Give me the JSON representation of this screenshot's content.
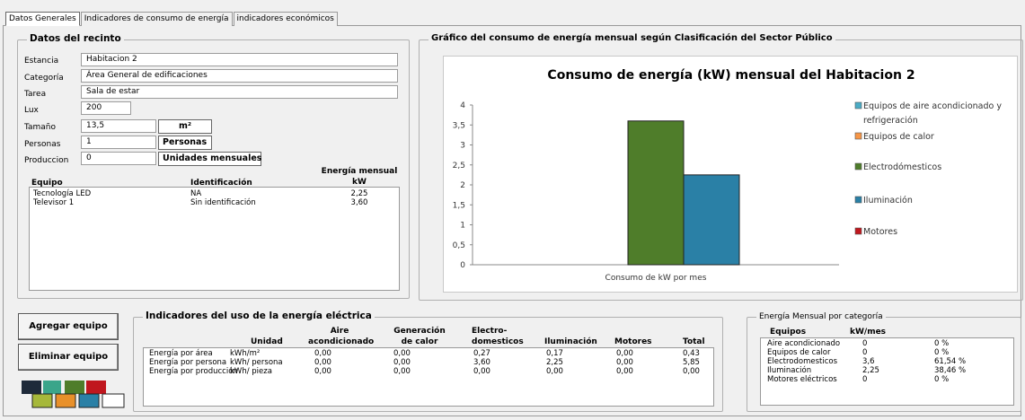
{
  "tabs": [
    {
      "label": "Datos Generales"
    },
    {
      "label": "Indicadores de consumo de energía"
    },
    {
      "label": "indicadores económicos"
    }
  ],
  "datos_recinto": {
    "title": "Datos del recinto",
    "fields": {
      "estancia": {
        "label": "Estancia",
        "value": "Habitacion 2"
      },
      "categoria": {
        "label": "Categoría",
        "value": "Área General de edificaciones"
      },
      "tarea": {
        "label": "Tarea",
        "value": "Sala de estar"
      },
      "lux": {
        "label": "Lux",
        "value": "200"
      },
      "tamano": {
        "label": "Tamaño",
        "value": "13,5",
        "unit": "m²"
      },
      "personas": {
        "label": "Personas",
        "value": "1",
        "unit": "Personas"
      },
      "produccion": {
        "label": "Produccion",
        "value": "0",
        "unit": "Unidades mensuales"
      }
    },
    "equipment_headers": {
      "equipo": "Equipo",
      "identificacion": "Identificación",
      "energia_1": "Energía mensual",
      "energia_2": "kW"
    },
    "equipment": [
      {
        "equipo": "Tecnología LED",
        "identificacion": "NA",
        "energia": "2,25"
      },
      {
        "equipo": "Televisor 1",
        "identificacion": "Sin identificación",
        "energia": "3,60"
      }
    ]
  },
  "grafico": {
    "frame_title": "Gráfico del consumo de energía mensual según Clasificación del Sector  Público"
  },
  "chart_data": {
    "type": "bar",
    "title": "Consumo de energía (kW) mensual del Habitacion 2",
    "categories": [
      "Consumo de kW por mes"
    ],
    "ylim": [
      0,
      4
    ],
    "yticks": [
      "0",
      "0,5",
      "1",
      "1,5",
      "2",
      "2,5",
      "3",
      "3,5",
      "4"
    ],
    "legend_position": "right",
    "series": [
      {
        "name": "Equipos de aire acondicionado y refrigeración",
        "values": [
          0
        ],
        "color": "#4bacc6"
      },
      {
        "name": "Equipos de calor",
        "values": [
          0
        ],
        "color": "#f79646"
      },
      {
        "name": "Electrodómesticos",
        "values": [
          3.6
        ],
        "color": "#4f7d2a"
      },
      {
        "name": "Iluminación",
        "values": [
          2.25
        ],
        "color": "#2a80a6"
      },
      {
        "name": "Motores",
        "values": [
          0
        ],
        "color": "#c0171e"
      }
    ],
    "legend_lines": [
      [
        "Equipos de aire acondicionado y",
        "refrigeración"
      ],
      [
        "Equipos de calor"
      ],
      [
        "Electrodómesticos"
      ],
      [
        "Iluminación"
      ],
      [
        "Motores"
      ]
    ]
  },
  "buttons": {
    "agregar": "Agregar equipo",
    "eliminar": "Eliminar equipo"
  },
  "indicadores": {
    "title": "Indicadores del uso de la energía eléctrica",
    "headers": {
      "unidad": "Unidad",
      "aire_1": "Aire",
      "aire_2": "acondicionado",
      "gen_1": "Generación",
      "gen_2": "de calor",
      "elec_1": "Electro-",
      "elec_2": "domesticos",
      "ilum": "Iluminación",
      "motores": "Motores",
      "total": "Total"
    },
    "rows": [
      {
        "name": "Energía por área",
        "unidad": "kWh/m²",
        "aire": "0,00",
        "calor": "0,00",
        "electro": "0,27",
        "ilum": "0,17",
        "motores": "0,00",
        "total": "0,43"
      },
      {
        "name": "Energía por persona",
        "unidad": "kWh/ persona",
        "aire": "0,00",
        "calor": "0,00",
        "electro": "3,60",
        "ilum": "2,25",
        "motores": "0,00",
        "total": "5,85"
      },
      {
        "name": "Energía por producción",
        "unidad": "kWh/ pieza",
        "aire": "0,00",
        "calor": "0,00",
        "electro": "0,00",
        "ilum": "0,00",
        "motores": "0,00",
        "total": "0,00"
      }
    ]
  },
  "categoria": {
    "title": "Energía Mensual por categoría",
    "headers": {
      "equipos": "Equipos",
      "kw": "kW/mes"
    },
    "rows": [
      {
        "name": "Aire acondicionado",
        "kw": "0",
        "pct": "0 %"
      },
      {
        "name": "Equipos de calor",
        "kw": "0",
        "pct": "0 %"
      },
      {
        "name": "Electrodomesticos",
        "kw": "3,6",
        "pct": "61,54 %"
      },
      {
        "name": "Iluminación",
        "kw": "2,25",
        "pct": "38,46 %"
      },
      {
        "name": "Motores eléctricos",
        "kw": "0",
        "pct": "0 %"
      }
    ]
  },
  "logo_colors": [
    "#1e2a3a",
    "#3aa58a",
    "#4f7d2a",
    "#c0171e",
    "#a6b83a",
    "#e8902a",
    "#2a80a6",
    "#ffffff"
  ]
}
